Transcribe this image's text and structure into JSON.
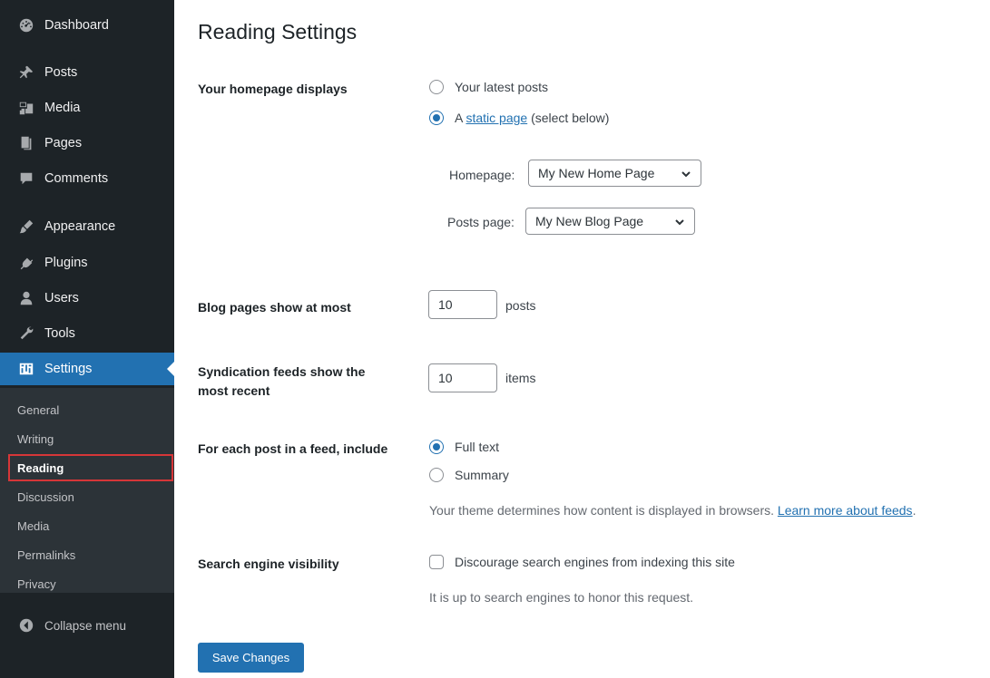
{
  "sidebar": {
    "items": [
      {
        "label": "Dashboard",
        "icon": "dashboard-icon"
      },
      {
        "label": "Posts",
        "icon": "pin-icon"
      },
      {
        "label": "Media",
        "icon": "media-icon"
      },
      {
        "label": "Pages",
        "icon": "pages-icon"
      },
      {
        "label": "Comments",
        "icon": "comment-icon"
      },
      {
        "label": "Appearance",
        "icon": "brush-icon"
      },
      {
        "label": "Plugins",
        "icon": "plug-icon"
      },
      {
        "label": "Users",
        "icon": "users-icon"
      },
      {
        "label": "Tools",
        "icon": "wrench-icon"
      },
      {
        "label": "Settings",
        "icon": "settings-icon",
        "active": true
      }
    ],
    "submenu": [
      "General",
      "Writing",
      "Reading",
      "Discussion",
      "Media",
      "Permalinks",
      "Privacy"
    ],
    "current_submenu": "Reading",
    "collapse_label": "Collapse menu",
    "accent_color": "#2271b1",
    "highlight_color": "#d63638"
  },
  "page": {
    "title": "Reading Settings"
  },
  "homepage": {
    "label": "Your homepage displays",
    "option_latest": "Your latest posts",
    "option_static_prefix": "A ",
    "option_static_link": "static page",
    "option_static_suffix": " (select below)",
    "selected": "static",
    "homepage_label": "Homepage:",
    "homepage_value": "My New Home Page",
    "posts_page_label": "Posts page:",
    "posts_page_value": "My New Blog Page"
  },
  "blog_pages": {
    "label": "Blog pages show at most",
    "value": "10",
    "unit": "posts"
  },
  "syndication": {
    "label_line1": "Syndication feeds show the",
    "label_line2": "most recent",
    "value": "10",
    "unit": "items"
  },
  "feed_content": {
    "label": "For each post in a feed, include",
    "option_full": "Full text",
    "option_summary": "Summary",
    "selected": "full",
    "desc_prefix": "Your theme determines how content is displayed in browsers. ",
    "desc_link": "Learn more about feeds",
    "desc_suffix": "."
  },
  "search_visibility": {
    "label": "Search engine visibility",
    "checkbox_label": "Discourage search engines from indexing this site",
    "checked": false,
    "desc": "It is up to search engines to honor this request."
  },
  "save_label": "Save Changes"
}
